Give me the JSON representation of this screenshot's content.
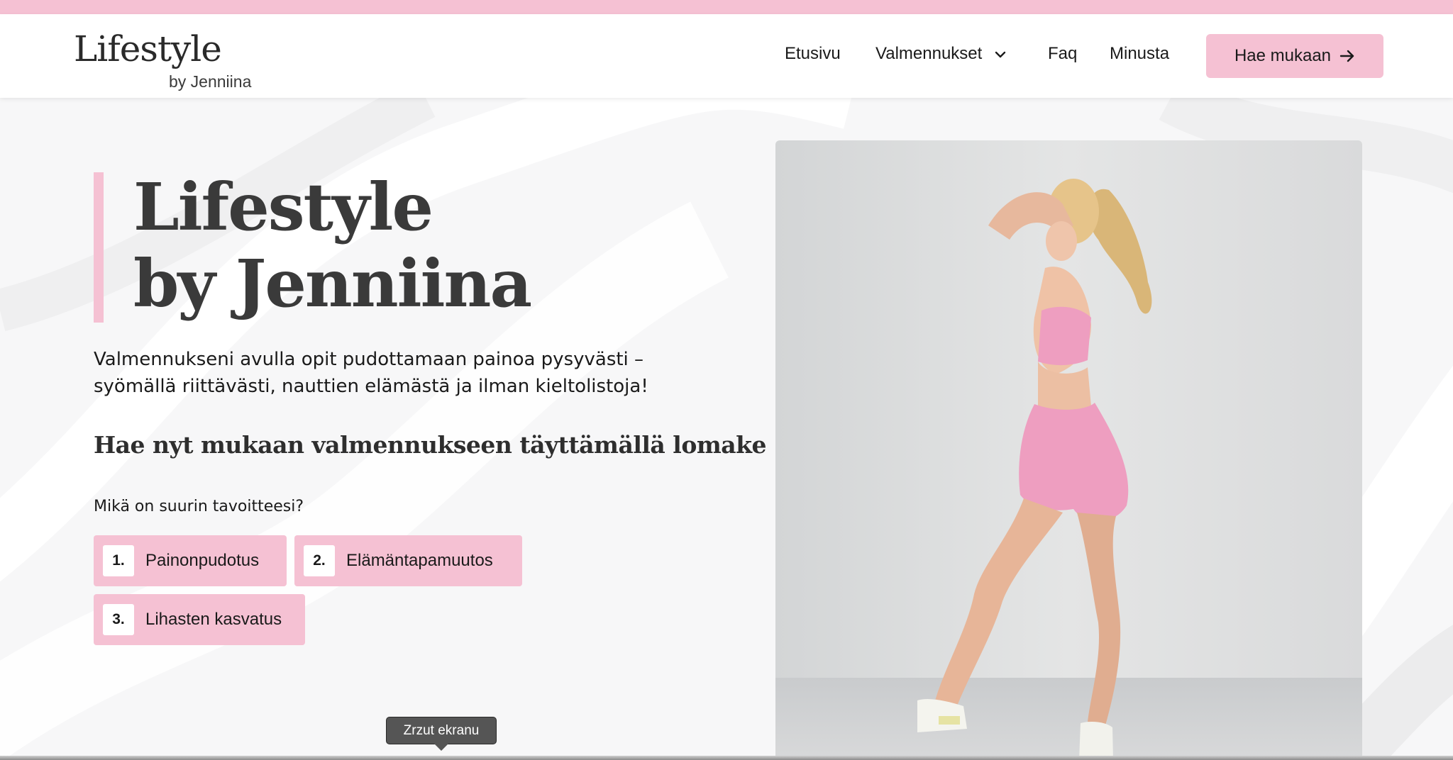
{
  "header": {
    "logo": {
      "main": "Lifestyle",
      "sub": "by Jenniina"
    },
    "nav": [
      {
        "label": "Etusivu"
      },
      {
        "label": "Valmennukset"
      },
      {
        "label": "Faq"
      },
      {
        "label": "Minusta"
      }
    ],
    "cta_label": "Hae mukaan"
  },
  "hero": {
    "title_line1": "Lifestyle",
    "title_line2": "by Jenniina",
    "description": "Valmennukseni avulla opit pudottamaan painoa pysyvästi – syömällä riittävästi, nauttien elämästä ja ilman kieltolistoja!",
    "subheading": "Hae nyt mukaan valmennukseen täyttämällä lomake",
    "question": "Mikä on suurin tavoitteesi?",
    "options": [
      {
        "number": "1.",
        "label": "Painonpudotus"
      },
      {
        "number": "2.",
        "label": "Elämäntapamuutos"
      },
      {
        "number": "3.",
        "label": "Lihasten kasvatus"
      }
    ]
  },
  "tooltip": {
    "label": "Zrzut ekranu"
  },
  "colors": {
    "accent_pink": "#f5c1d3",
    "heading_gray": "#3a3a3a"
  }
}
